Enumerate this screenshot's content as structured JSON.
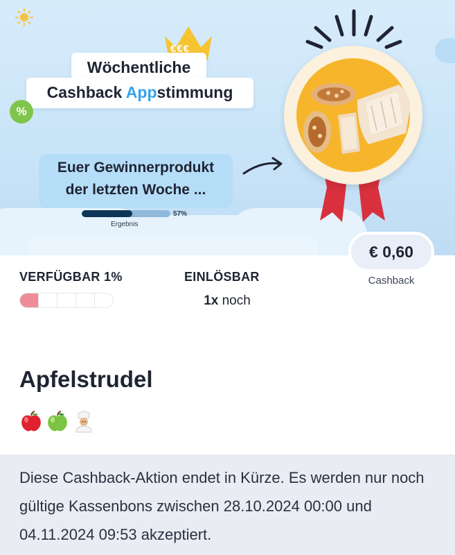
{
  "banner": {
    "title_line1": "Wöchentliche",
    "title_line2_pre": "Cashback ",
    "title_line2_accent": "App",
    "title_line2_post": "stimmung",
    "crown_text": "€€€",
    "percent_badge": "%",
    "winner_line1": "Euer Gewinnerprodukt",
    "winner_line2": "der letzten Woche ...",
    "result_percent_label": "57%",
    "result_fraction": 0.57,
    "result_label": "Ergebnis",
    "accent_color": "#36a3ea"
  },
  "offer": {
    "price": "€ 0,60",
    "price_label": "Cashback",
    "available_label": "VERFÜGBAR 1%",
    "available_fraction": 0.01,
    "redeemable_label": "EINLÖSBAR",
    "redeemable_count": "1x",
    "redeemable_suffix": " noch"
  },
  "product": {
    "name": "Apfelstrudel",
    "tags": [
      "red-apple-icon",
      "green-apple-icon",
      "chef-icon"
    ]
  },
  "notice": {
    "text": "Diese Cashback-Aktion endet in Kürze. Es werden nur noch gültige Kassenbons zwischen 28.10.2024 00:00 und 04.11.2024 09:53 akzeptiert."
  }
}
